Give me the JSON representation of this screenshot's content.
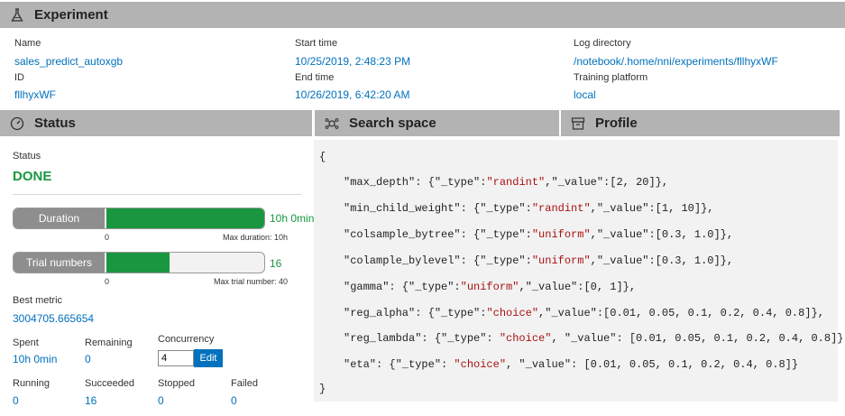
{
  "experiment": {
    "title": "Experiment",
    "name_label": "Name",
    "name": "sales_predict_autoxgb",
    "id_label": "ID",
    "id": "fllhyxWF",
    "start_label": "Start time",
    "start": "10/25/2019, 2:48:23 PM",
    "end_label": "End time",
    "end": "10/26/2019, 6:42:20 AM",
    "logdir_label": "Log directory",
    "logdir": "/notebook/.home/nni/experiments/fllhyxWF",
    "platform_label": "Training platform",
    "platform": "local"
  },
  "tabs": {
    "status": "Status",
    "search_space": "Search space",
    "profile": "Profile"
  },
  "status": {
    "label": "Status",
    "value": "DONE",
    "duration": {
      "label": "Duration",
      "value": "10h 0min",
      "min": "0",
      "max_text": "Max duration: 10h",
      "fraction": 1.0
    },
    "trials": {
      "label": "Trial numbers",
      "value": "16",
      "min": "0",
      "max_text": "Max trial number: 40",
      "fraction": 0.4
    },
    "best_metric_label": "Best metric",
    "best_metric": "3004705.665654",
    "spent_label": "Spent",
    "spent": "10h 0min",
    "remaining_label": "Remaining",
    "remaining": "0",
    "concurrency_label": "Concurrency",
    "concurrency": "4",
    "edit_label": "Edit",
    "running_label": "Running",
    "running": "0",
    "succeeded_label": "Succeeded",
    "succeeded": "16",
    "stopped_label": "Stopped",
    "stopped": "0",
    "failed_label": "Failed",
    "failed": "0"
  },
  "search_space": {
    "open": "{",
    "close": "}",
    "lines": [
      {
        "key": "\"max_depth\": {\"_type\":",
        "type": "\"randint\"",
        "rest": ",\"_value\":[2, 20]},"
      },
      {
        "key": "\"min_child_weight\": {\"_type\":",
        "type": "\"randint\"",
        "rest": ",\"_value\":[1, 10]},"
      },
      {
        "key": "\"colsample_bytree\": {\"_type\":",
        "type": "\"uniform\"",
        "rest": ",\"_value\":[0.3, 1.0]},"
      },
      {
        "key": "\"colample_bylevel\": {\"_type\":",
        "type": "\"uniform\"",
        "rest": ",\"_value\":[0.3, 1.0]},"
      },
      {
        "key": "\"gamma\": {\"_type\":",
        "type": "\"uniform\"",
        "rest": ",\"_value\":[0, 1]},"
      },
      {
        "key": "\"reg_alpha\": {\"_type\":",
        "type": "\"choice\"",
        "rest": ",\"_value\":[0.01, 0.05, 0.1, 0.2, 0.4, 0.8]},"
      },
      {
        "key": "\"reg_lambda\": {\"_type\": ",
        "type": "\"choice\"",
        "rest": ", \"_value\": [0.01, 0.05, 0.1, 0.2, 0.4, 0.8]},"
      },
      {
        "key": "\"eta\": {\"_type\": ",
        "type": "\"choice\"",
        "rest": ", \"_value\": [0.01, 0.05, 0.1, 0.2, 0.4, 0.8]}"
      }
    ]
  },
  "icons": {
    "experiment": "flask-icon",
    "status": "gauge-icon",
    "search_space": "cluster-icon",
    "profile": "archive-box-icon"
  }
}
